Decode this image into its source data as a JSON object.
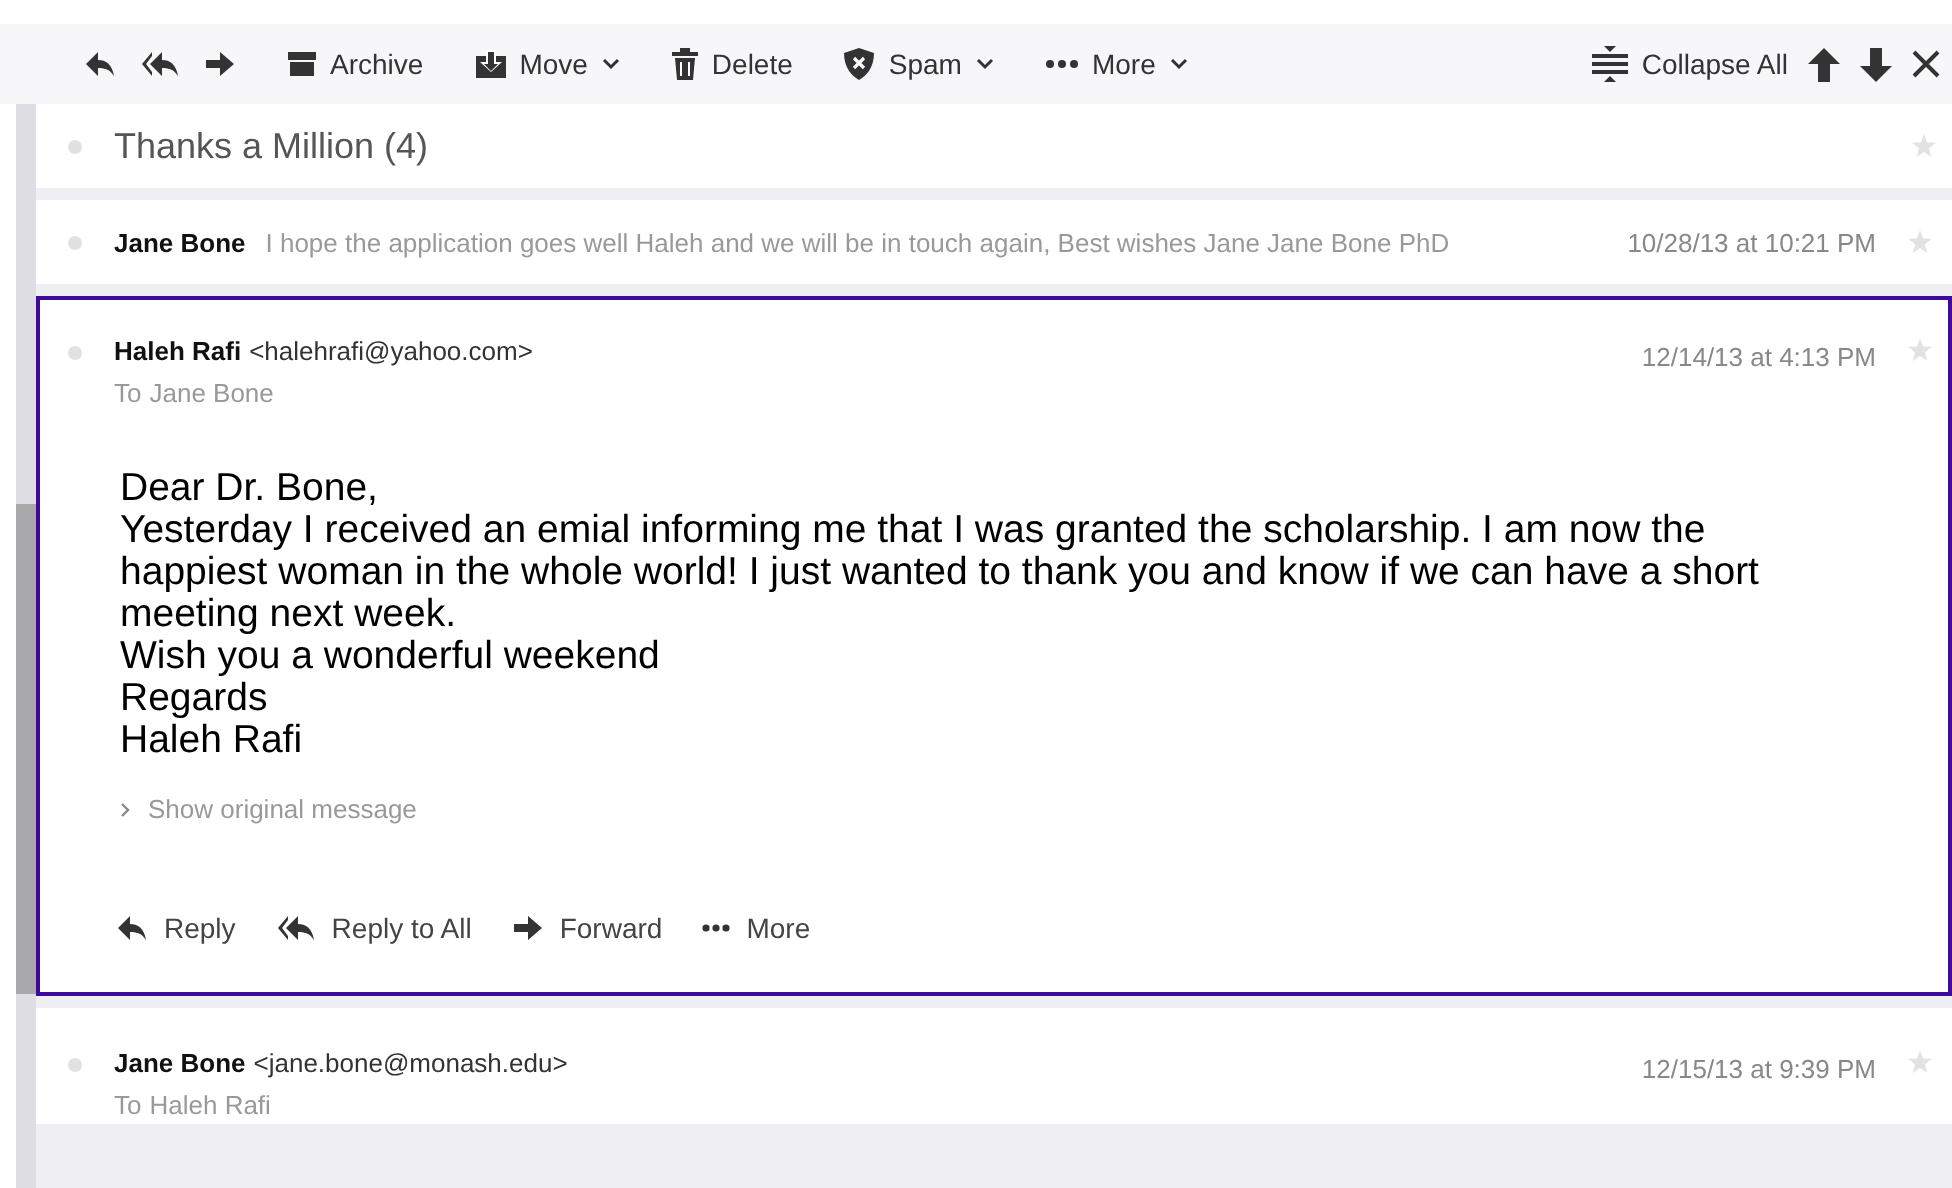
{
  "toolbar": {
    "nav": [
      {
        "kind": "reply"
      },
      {
        "kind": "reply-all"
      },
      {
        "kind": "forward"
      }
    ],
    "actions": [
      {
        "kind": "archive",
        "label": "Archive",
        "dropdown": false
      },
      {
        "kind": "move",
        "label": "Move",
        "dropdown": true
      },
      {
        "kind": "delete",
        "label": "Delete",
        "dropdown": false
      },
      {
        "kind": "spam",
        "label": "Spam",
        "dropdown": true
      },
      {
        "kind": "more",
        "label": "More",
        "dropdown": true
      }
    ],
    "collapse_label": "Collapse All"
  },
  "thread": {
    "title": "Thanks a Million (4)"
  },
  "messages": [
    {
      "kind": "collapsed",
      "selected": false,
      "sender": "Jane Bone",
      "preview": "I hope the application goes well Haleh and we will be in touch again, Best wishes Jane Jane Bone PhD",
      "time": "10/28/13 at 10:21 PM"
    },
    {
      "kind": "expanded",
      "selected": true,
      "sender": "Haleh Rafi",
      "email": "<halehrafi@yahoo.com>",
      "to_label": "To",
      "to": "Jane Bone",
      "time": "12/14/13 at 4:13 PM",
      "body": [
        "Dear Dr. Bone,",
        "Yesterday I received an emial informing me that I was granted the scholarship. I am now the happiest woman in the whole world! I just wanted to thank you and know if we can have a short meeting next week.",
        "Wish you a wonderful weekend",
        "Regards",
        "Haleh Rafi"
      ],
      "show_original": "Show original message",
      "actions": [
        {
          "kind": "reply",
          "label": "Reply"
        },
        {
          "kind": "reply-all",
          "label": "Reply to All"
        },
        {
          "kind": "forward",
          "label": "Forward"
        },
        {
          "kind": "more",
          "label": "More"
        }
      ]
    },
    {
      "kind": "header",
      "selected": false,
      "sender": "Jane Bone",
      "email": "<jane.bone@monash.edu>",
      "to_label": "To",
      "to": "Haleh Rafi",
      "time": "12/15/13 at 9:39 PM"
    }
  ]
}
